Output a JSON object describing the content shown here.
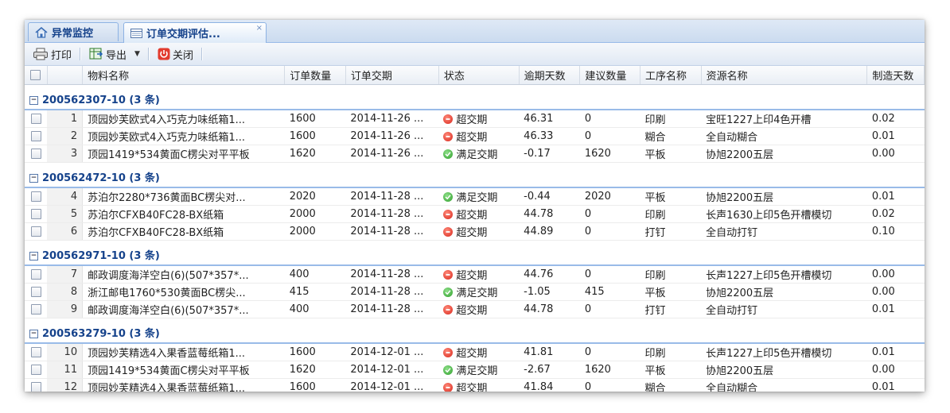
{
  "tabs": [
    {
      "label": "异常监控",
      "icon": "home-icon",
      "active": false
    },
    {
      "label": "订单交期评估...",
      "icon": "grid-icon",
      "active": true,
      "close": "×"
    }
  ],
  "toolbar": {
    "print_label": "打印",
    "export_label": "导出",
    "close_label": "关闭"
  },
  "columns": [
    "物料名称",
    "订单数量",
    "订单交期",
    "状态",
    "逾期天数",
    "建议数量",
    "工序名称",
    "资源名称",
    "制造天数"
  ],
  "groups": [
    {
      "title": "200562307-10 (3 条)",
      "rows": [
        {
          "num": "1",
          "name": "顶园妙芙欧式4入巧克力味纸箱1...",
          "qty": "1600",
          "date": "2014-11-26 ...",
          "status": "超交期",
          "status_type": "overdue",
          "overdue_days": "46.31",
          "suggested": "0",
          "process": "印刷",
          "resource": "宝旺1227上印4色开槽",
          "mfg_days": "0.02"
        },
        {
          "num": "2",
          "name": "顶园妙芙欧式4入巧克力味纸箱1...",
          "qty": "1600",
          "date": "2014-11-26 ...",
          "status": "超交期",
          "status_type": "overdue",
          "overdue_days": "46.33",
          "suggested": "0",
          "process": "糊合",
          "resource": "全自动糊合",
          "mfg_days": "0.01"
        },
        {
          "num": "3",
          "name": "顶园1419*534黄面C楞尖对平平板",
          "qty": "1620",
          "date": "2014-11-26 ...",
          "status": "满足交期",
          "status_type": "ok",
          "overdue_days": "-0.17",
          "suggested": "1620",
          "process": "平板",
          "resource": "协旭2200五层",
          "mfg_days": "0.00"
        }
      ]
    },
    {
      "title": "200562472-10 (3 条)",
      "rows": [
        {
          "num": "4",
          "name": "苏泊尔2280*736黄面BC楞尖对...",
          "qty": "2020",
          "date": "2014-11-28 ...",
          "status": "满足交期",
          "status_type": "ok",
          "overdue_days": "-0.44",
          "suggested": "2020",
          "process": "平板",
          "resource": "协旭2200五层",
          "mfg_days": "0.01"
        },
        {
          "num": "5",
          "name": "苏泊尔CFXB40FC28-BX纸箱",
          "qty": "2000",
          "date": "2014-11-28 ...",
          "status": "超交期",
          "status_type": "overdue",
          "overdue_days": "44.78",
          "suggested": "0",
          "process": "印刷",
          "resource": "长声1630上印5色开槽模切",
          "mfg_days": "0.02"
        },
        {
          "num": "6",
          "name": "苏泊尔CFXB40FC28-BX纸箱",
          "qty": "2000",
          "date": "2014-11-28 ...",
          "status": "超交期",
          "status_type": "overdue",
          "overdue_days": "44.89",
          "suggested": "0",
          "process": "打钉",
          "resource": "全自动打钉",
          "mfg_days": "0.10"
        }
      ]
    },
    {
      "title": "200562971-10 (3 条)",
      "rows": [
        {
          "num": "7",
          "name": "邮政调度海洋空白(6)(507*357*...",
          "qty": "400",
          "date": "2014-11-28 ...",
          "status": "超交期",
          "status_type": "overdue",
          "overdue_days": "44.76",
          "suggested": "0",
          "process": "印刷",
          "resource": "长声1227上印5色开槽模切",
          "mfg_days": "0.00"
        },
        {
          "num": "8",
          "name": "浙江邮电1760*530黄面BC楞尖...",
          "qty": "415",
          "date": "2014-11-28 ...",
          "status": "满足交期",
          "status_type": "ok",
          "overdue_days": "-1.05",
          "suggested": "415",
          "process": "平板",
          "resource": "协旭2200五层",
          "mfg_days": "0.00"
        },
        {
          "num": "9",
          "name": "邮政调度海洋空白(6)(507*357*...",
          "qty": "400",
          "date": "2014-11-28 ...",
          "status": "超交期",
          "status_type": "overdue",
          "overdue_days": "44.78",
          "suggested": "0",
          "process": "打钉",
          "resource": "全自动打钉",
          "mfg_days": "0.01"
        }
      ]
    },
    {
      "title": "200563279-10 (3 条)",
      "rows": [
        {
          "num": "10",
          "name": "顶园妙芙精选4入果香蓝莓纸箱1...",
          "qty": "1600",
          "date": "2014-12-01 ...",
          "status": "超交期",
          "status_type": "overdue",
          "overdue_days": "41.81",
          "suggested": "0",
          "process": "印刷",
          "resource": "长声1227上印5色开槽模切",
          "mfg_days": "0.01"
        },
        {
          "num": "11",
          "name": "顶园1419*534黄面C楞尖对平平板",
          "qty": "1620",
          "date": "2014-12-01 ...",
          "status": "满足交期",
          "status_type": "ok",
          "overdue_days": "-2.67",
          "suggested": "1620",
          "process": "平板",
          "resource": "协旭2200五层",
          "mfg_days": "0.00"
        },
        {
          "num": "12",
          "name": "顶园妙芙精选4入果香蓝莓纸箱1...",
          "qty": "1600",
          "date": "2014-12-01 ...",
          "status": "超交期",
          "status_type": "overdue",
          "overdue_days": "41.84",
          "suggested": "0",
          "process": "糊合",
          "resource": "全自动糊合",
          "mfg_days": "0.01"
        }
      ]
    }
  ],
  "colors": {
    "header_blue": "#15428b",
    "overdue": "#d8261b",
    "ok": "#2e9e2a"
  }
}
